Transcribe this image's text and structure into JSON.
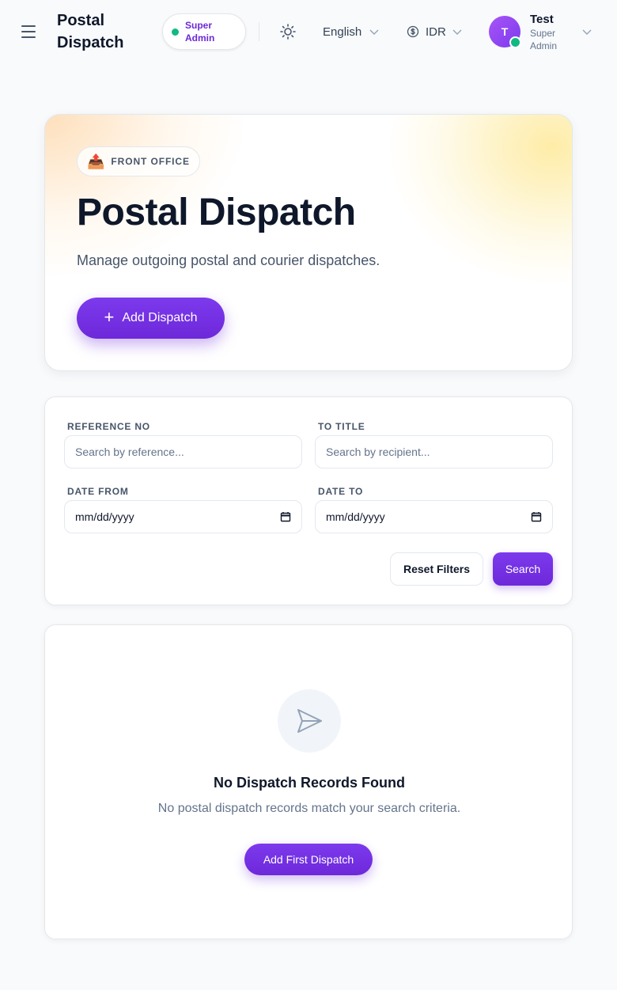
{
  "header": {
    "app_title": "Postal Dispatch",
    "role_badge": "Super Admin",
    "language": "English",
    "currency": "IDR",
    "user": {
      "initial": "T",
      "name": "Test",
      "role": "Super Admin"
    }
  },
  "hero": {
    "category_label": "FRONT OFFICE",
    "category_icon": "outbox-tray-icon",
    "title": "Postal Dispatch",
    "description": "Manage outgoing postal and courier dispatches.",
    "add_button_label": "Add Dispatch"
  },
  "filters": {
    "reference_no": {
      "label": "REFERENCE NO",
      "placeholder": "Search by reference...",
      "value": ""
    },
    "to_title": {
      "label": "TO TITLE",
      "placeholder": "Search by recipient...",
      "value": ""
    },
    "date_from": {
      "label": "DATE FROM",
      "value": "mm/dd/yyyy"
    },
    "date_to": {
      "label": "DATE TO",
      "value": "mm/dd/yyyy"
    },
    "reset_label": "Reset Filters",
    "search_label": "Search"
  },
  "empty_state": {
    "icon": "paper-plane-icon",
    "title": "No Dispatch Records Found",
    "description": "No postal dispatch records match your search criteria.",
    "button_label": "Add First Dispatch"
  },
  "colors": {
    "accent": "#7c3aed",
    "role_text": "#6d28d9",
    "status_online": "#10b981"
  }
}
